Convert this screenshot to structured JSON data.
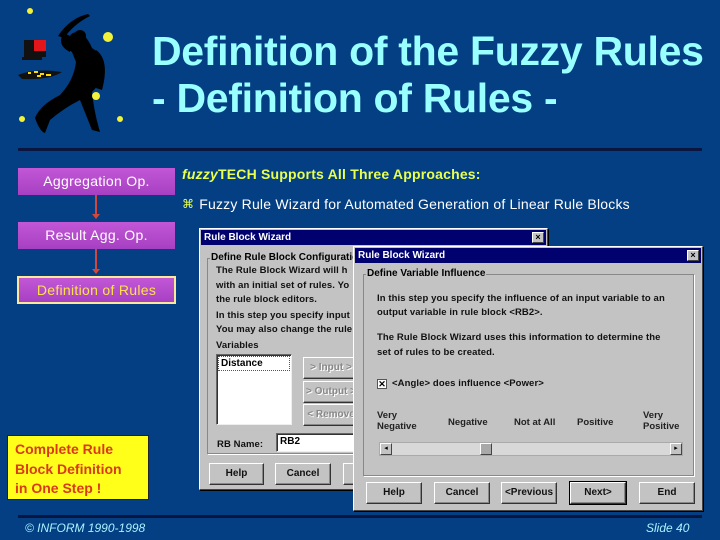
{
  "title": {
    "line1": "Definition of the Fuzzy Rules",
    "line2": "- Definition of Rules -"
  },
  "logo": {
    "icon": "dancing-figure-with-computer-logo"
  },
  "flow": {
    "steps": [
      {
        "label": "Aggregation Op.",
        "active": false
      },
      {
        "label": "Result Agg. Op.",
        "active": false
      },
      {
        "label": "Definition of Rules",
        "active": true
      }
    ]
  },
  "content": {
    "support_brand": "fuzzy",
    "support_rest": "TECH Supports All Three Approaches:",
    "bullet_icon": "wizard-bullet-icon",
    "bullet_text": "Fuzzy Rule Wizard for Automated Generation of Linear Rule Blocks"
  },
  "callout": {
    "line1": "Complete Rule",
    "line2": "Block Definition",
    "line3": "in One Step !"
  },
  "dialog_back": {
    "title": "Rule Block Wizard",
    "close": "×",
    "group_title": "Define Rule Block Configuratio",
    "lines": [
      "The Rule Block Wizard will h",
      "with an initial set of rules. Yo",
      "the rule block editors.",
      "In this step you specify input",
      "You may also change the rule"
    ],
    "variables_label": "Variables",
    "variables": [
      "Distance"
    ],
    "buttons": {
      "input": "> Input >",
      "output": "> Output >",
      "remove": "< Remove"
    },
    "rb_name_label": "RB Name:",
    "rb_name_value": "RB2",
    "help": "Help",
    "cancel": "Cancel"
  },
  "dialog_front": {
    "title": "Rule Block Wizard",
    "close": "×",
    "group_title": "Define Variable Influence",
    "para1_line1": "In this step you specify the influence of an input variable to an",
    "para1_line2": "output variable in rule block <RB2>.",
    "para2_line1": "The Rule Block Wizard uses this information to determine the",
    "para2_line2": "set of rules to be created.",
    "checkbox_checked": true,
    "checkbox_label": "<Angle> does influence <Power>",
    "scale_labels": [
      [
        "Very",
        "Negative"
      ],
      [
        "Negative"
      ],
      [
        "Not at All"
      ],
      [
        "Positive"
      ],
      [
        "Very",
        "Positive"
      ]
    ],
    "slider_value_fraction": 0.33,
    "slider_setting": "Negative",
    "buttons": {
      "help": "Help",
      "cancel": "Cancel",
      "previous": "<Previous",
      "next": "Next>",
      "end": "End"
    }
  },
  "footer": {
    "copyright": "© INFORM 1990-1998",
    "slide": "Slide 40"
  }
}
